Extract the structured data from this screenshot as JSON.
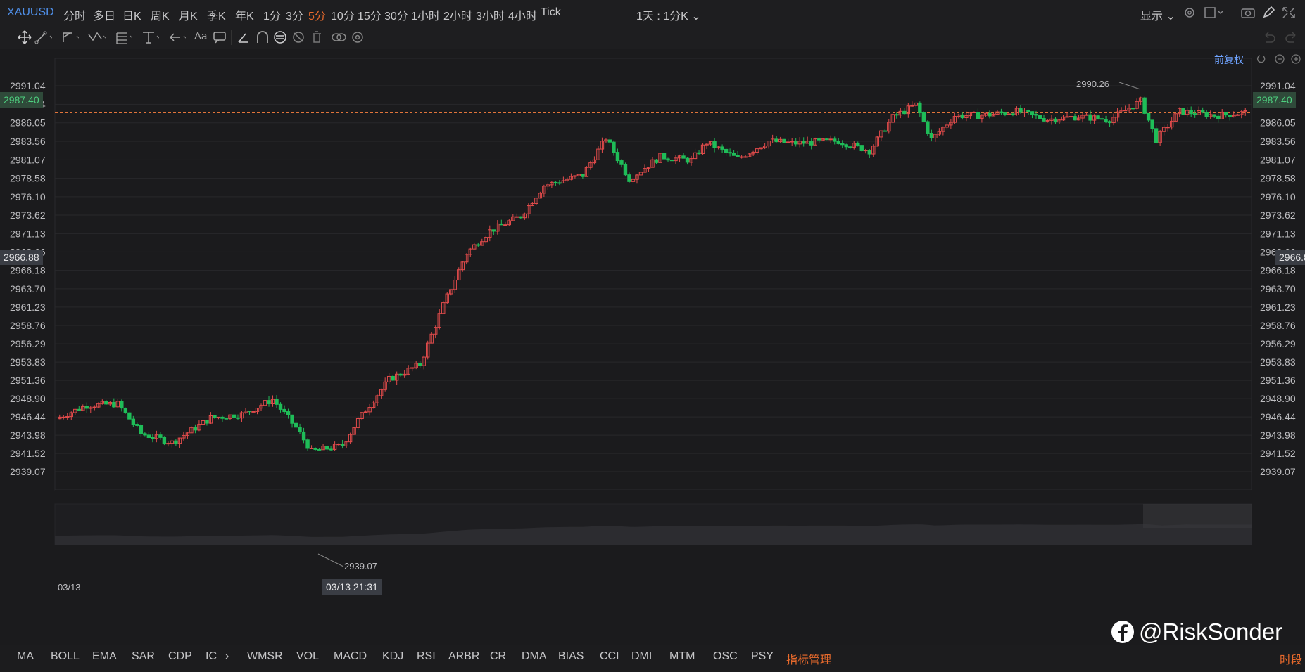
{
  "topbar": {
    "symbol": "XAUUSD",
    "timeframes": [
      "分时",
      "多日",
      "日K",
      "周K",
      "月K",
      "季K",
      "年K",
      "1分",
      "3分",
      "5分",
      "10分",
      "15分",
      "30分",
      "1小时",
      "2小时",
      "3小时",
      "4小时",
      "Tick"
    ],
    "active_timeframe": "5分",
    "period_select": "1天 : 1分K",
    "display_label": "显示"
  },
  "toolbar": {
    "text_tool_label": "Aa"
  },
  "chart": {
    "restore_label": "前复权",
    "y_ticks": [
      "2991.04",
      "2988.54",
      "2986.05",
      "2983.56",
      "2981.07",
      "2978.58",
      "2976.10",
      "2973.62",
      "2971.13",
      "2968.66",
      "2966.18",
      "2963.70",
      "2961.23",
      "2958.76",
      "2956.29",
      "2953.83",
      "2951.36",
      "2948.90",
      "2946.44",
      "2943.98",
      "2941.52",
      "2939.07"
    ],
    "last_price": "2987.40",
    "crosshair_price": "2966.88",
    "high_label": "2990.26",
    "low_label": "2939.07",
    "x_label": "03/13",
    "crosshair_time": "03/13 21:31",
    "up_color": "#e24b4b",
    "down_color": "#1fbd58",
    "last_price_color": "#e0743a"
  },
  "bottombar": {
    "indicators_left": [
      "MA",
      "BOLL",
      "EMA",
      "SAR",
      "CDP",
      "IC"
    ],
    "indicators_right": [
      "WMSR",
      "VOL",
      "MACD",
      "KDJ",
      "RSI",
      "ARBR",
      "CR",
      "DMA",
      "BIAS",
      "CCI",
      "DMI",
      "MTM",
      "OSC",
      "PSY"
    ],
    "manage_label": "指标管理",
    "session_label": "时段"
  },
  "watermark": {
    "handle": "@RiskSonder"
  }
}
